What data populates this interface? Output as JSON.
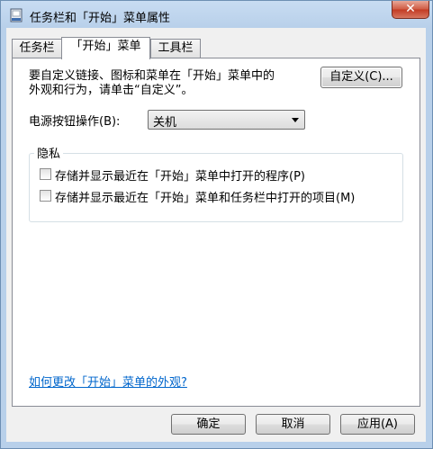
{
  "window": {
    "title": "任务栏和「开始」菜单属性",
    "close_label": "✕"
  },
  "tabs": [
    {
      "label": "任务栏",
      "active": false
    },
    {
      "label": "「开始」菜单",
      "active": true
    },
    {
      "label": "工具栏",
      "active": false
    }
  ],
  "start_menu": {
    "description_line1": "要自定义链接、图标和菜单在「开始」菜单中的",
    "description_line2": "外观和行为，请单击“自定义”。",
    "customize_button": "自定义(C)...",
    "power_label": "电源按钮操作(B):",
    "power_value": "关机"
  },
  "privacy": {
    "title": "隐私",
    "items": [
      {
        "label": "存储并显示最近在「开始」菜单中打开的程序(P)",
        "checked": false
      },
      {
        "label": "存储并显示最近在「开始」菜单和任务栏中打开的项目(M)",
        "checked": false
      }
    ]
  },
  "help_link": "如何更改「开始」菜单的外观?",
  "footer": {
    "ok": "确定",
    "cancel": "取消",
    "apply": "应用(A)"
  }
}
